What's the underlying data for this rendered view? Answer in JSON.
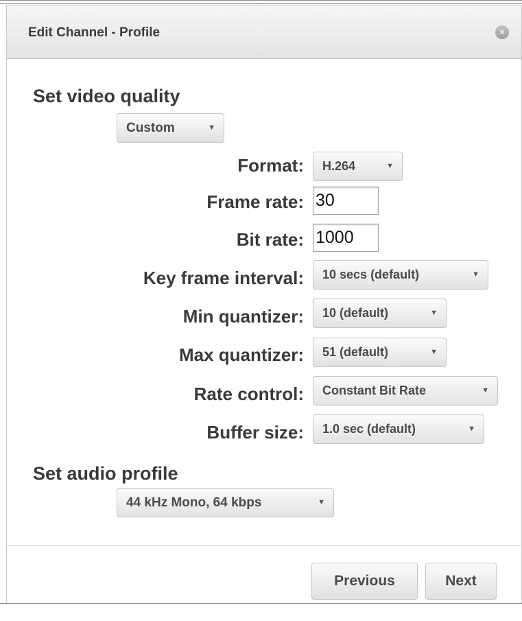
{
  "dialog": {
    "title": "Edit Channel - Profile",
    "close_glyph": "✕"
  },
  "video": {
    "heading": "Set video quality",
    "quality_select": "Custom",
    "format_label": "Format:",
    "format_select": "H.264",
    "frame_rate_label": "Frame rate:",
    "frame_rate_value": "30",
    "bit_rate_label": "Bit rate:",
    "bit_rate_value": "1000",
    "key_frame_label": "Key frame interval:",
    "key_frame_select": "10 secs (default)",
    "min_q_label": "Min quantizer:",
    "min_q_select": "10 (default)",
    "max_q_label": "Max quantizer:",
    "max_q_select": "51 (default)",
    "rate_control_label": "Rate control:",
    "rate_control_select": "Constant Bit Rate",
    "buffer_label": "Buffer size:",
    "buffer_select": "1.0 sec (default)"
  },
  "audio": {
    "heading": "Set audio profile",
    "profile_select": "44 kHz Mono, 64 kbps"
  },
  "footer": {
    "previous_label": "Previous",
    "next_label": "Next"
  },
  "icons": {
    "caret": "▼"
  }
}
